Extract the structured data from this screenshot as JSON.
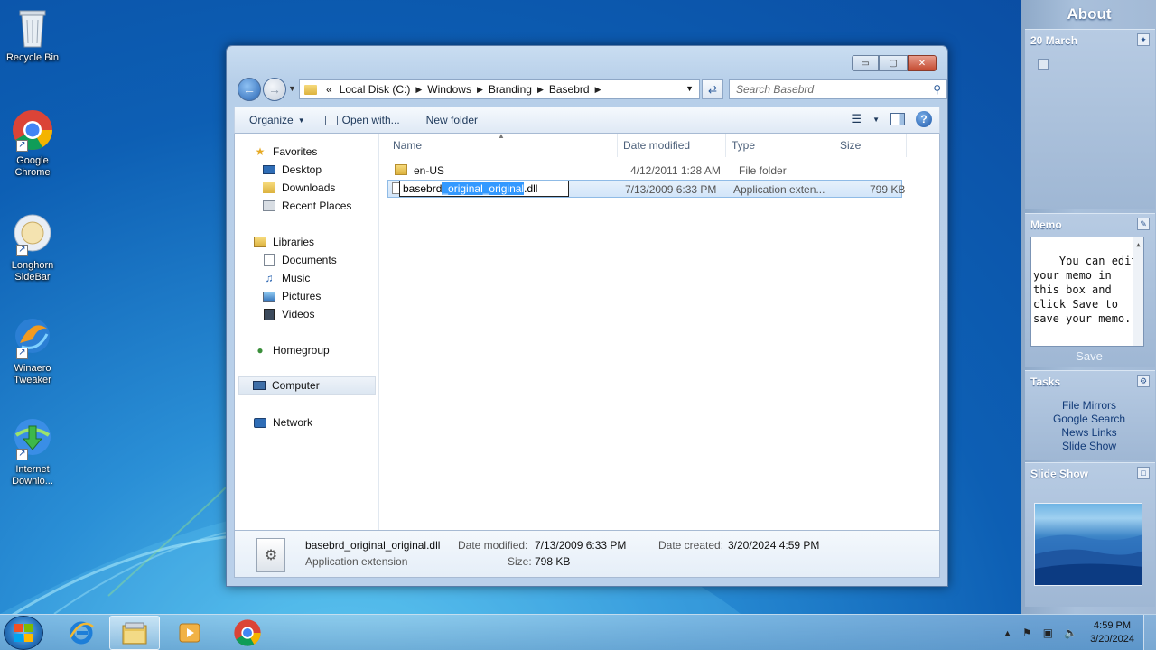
{
  "desktop": {
    "icons": [
      {
        "label": "Recycle Bin"
      },
      {
        "label": "Google Chrome"
      },
      {
        "label": "Longhorn SideBar"
      },
      {
        "label": "Winaero Tweaker"
      },
      {
        "label": "Internet Downlo..."
      }
    ]
  },
  "explorer": {
    "controls": {
      "minimize": "▭",
      "maximize": "▢",
      "close": "✕"
    },
    "breadcrumb": {
      "overflow": "«",
      "items": [
        "Local Disk (C:)",
        "Windows",
        "Branding",
        "Basebrd"
      ]
    },
    "search_placeholder": "Search Basebrd",
    "toolbar": {
      "organize": "Organize",
      "open_with": "Open with...",
      "new_folder": "New folder"
    },
    "nav": {
      "favorites": "Favorites",
      "desktop": "Desktop",
      "downloads": "Downloads",
      "recent_places": "Recent Places",
      "libraries": "Libraries",
      "documents": "Documents",
      "music": "Music",
      "pictures": "Pictures",
      "videos": "Videos",
      "homegroup": "Homegroup",
      "computer": "Computer",
      "network": "Network"
    },
    "columns": {
      "name": "Name",
      "date": "Date modified",
      "type": "Type",
      "size": "Size"
    },
    "files": [
      {
        "name": "en-US",
        "date": "4/12/2011 1:28 AM",
        "type": "File folder",
        "size": ""
      },
      {
        "name_prefix": "basebrd",
        "name_highlight": "_original_original",
        "name_suffix": ".dll",
        "date": "7/13/2009 6:33 PM",
        "type": "Application exten...",
        "size": "799 KB"
      }
    ],
    "details": {
      "filename": "basebrd_original_original.dll",
      "filetype": "Application extension",
      "modified_label": "Date modified:",
      "modified_value": "7/13/2009 6:33 PM",
      "created_label": "Date created:",
      "created_value": "3/20/2024 4:59 PM",
      "size_label": "Size:",
      "size_value": "798 KB"
    }
  },
  "sidebar": {
    "title": "About",
    "date": "20 March",
    "memo": {
      "title": "Memo",
      "text": "You can edit your memo in this box and click Save to save your memo.",
      "save": "Save"
    },
    "tasks": {
      "title": "Tasks",
      "links": [
        "File Mirrors",
        "Google Search",
        "News Links",
        "Slide Show"
      ]
    },
    "slideshow": {
      "title": "Slide Show"
    }
  },
  "taskbar": {
    "clock_time": "4:59 PM",
    "clock_date": "3/20/2024"
  }
}
